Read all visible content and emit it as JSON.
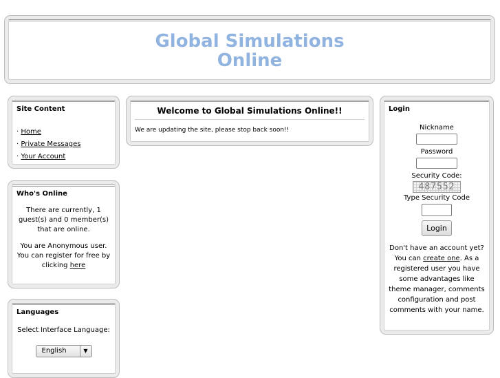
{
  "header": {
    "title_line1": "Global Simulations",
    "title_line2": "Online"
  },
  "site_content": {
    "title": "Site Content",
    "items": [
      {
        "bullet": "·",
        "label": "Home"
      },
      {
        "bullet": "·",
        "label": "Private Messages"
      },
      {
        "bullet": "·",
        "label": "Your Account"
      }
    ]
  },
  "whos_online": {
    "title": "Who's Online",
    "status_text": "There are currently, 1 guest(s) and 0 member(s) that are online.",
    "anon_text": "You are Anonymous user. You can register for free by clicking",
    "register_link": "here"
  },
  "languages": {
    "title": "Languages",
    "prompt": "Select Interface Language:",
    "selected": "English"
  },
  "welcome": {
    "title": "Welcome to Global Simulations Online!!",
    "message": "We are updating the site, please stop back soon!!"
  },
  "login": {
    "title": "Login",
    "nickname_label": "Nickname",
    "password_label": "Password",
    "security_code_label": "Security Code:",
    "security_code": "487552",
    "type_code_label": "Type Security Code",
    "login_button": "Login",
    "register_prefix": "Don't have an account yet? You can",
    "create_link": "create one",
    "register_suffix": ". As a registered user you have some advantages like theme manager, comments configuration and post comments with your name."
  }
}
